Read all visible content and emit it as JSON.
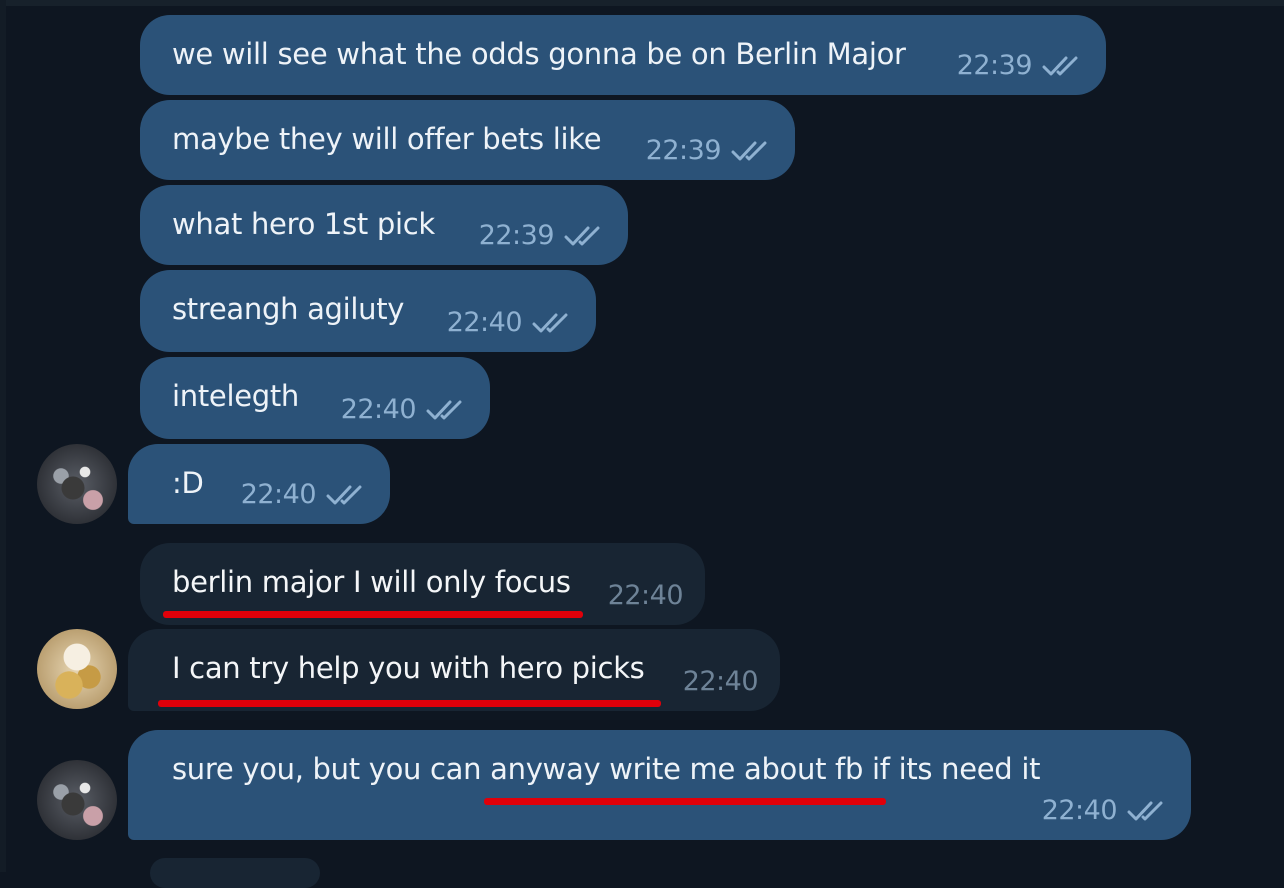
{
  "messages": [
    {
      "text": "we will see what the odds gonna be on Berlin Major",
      "time": "22:39",
      "direction": "outgoing",
      "status": "read"
    },
    {
      "text": "maybe they will offer bets like",
      "time": "22:39",
      "direction": "outgoing",
      "status": "read"
    },
    {
      "text": "what hero 1st pick",
      "time": "22:39",
      "direction": "outgoing",
      "status": "read"
    },
    {
      "text": "streangh agiluty",
      "time": "22:40",
      "direction": "outgoing",
      "status": "read"
    },
    {
      "text": "intelegth",
      "time": "22:40",
      "direction": "outgoing",
      "status": "read"
    },
    {
      "text": ":D",
      "time": "22:40",
      "direction": "outgoing",
      "status": "read"
    },
    {
      "text": "berlin major I will only focus",
      "time": "22:40",
      "direction": "incoming"
    },
    {
      "text": "I can try help you with hero picks",
      "time": "22:40",
      "direction": "incoming"
    },
    {
      "text": "sure you, but you can anyway write me about fb if its need it",
      "time": "22:40",
      "direction": "outgoing",
      "status": "read"
    }
  ],
  "colors": {
    "background": "#0e1621",
    "outgoing_bubble": "#2b5278",
    "incoming_bubble": "#182533",
    "highlight_underline": "#e0000a",
    "read_ticks": "#8fb1d1"
  },
  "icons": {
    "read_status": "double-check-icon"
  }
}
